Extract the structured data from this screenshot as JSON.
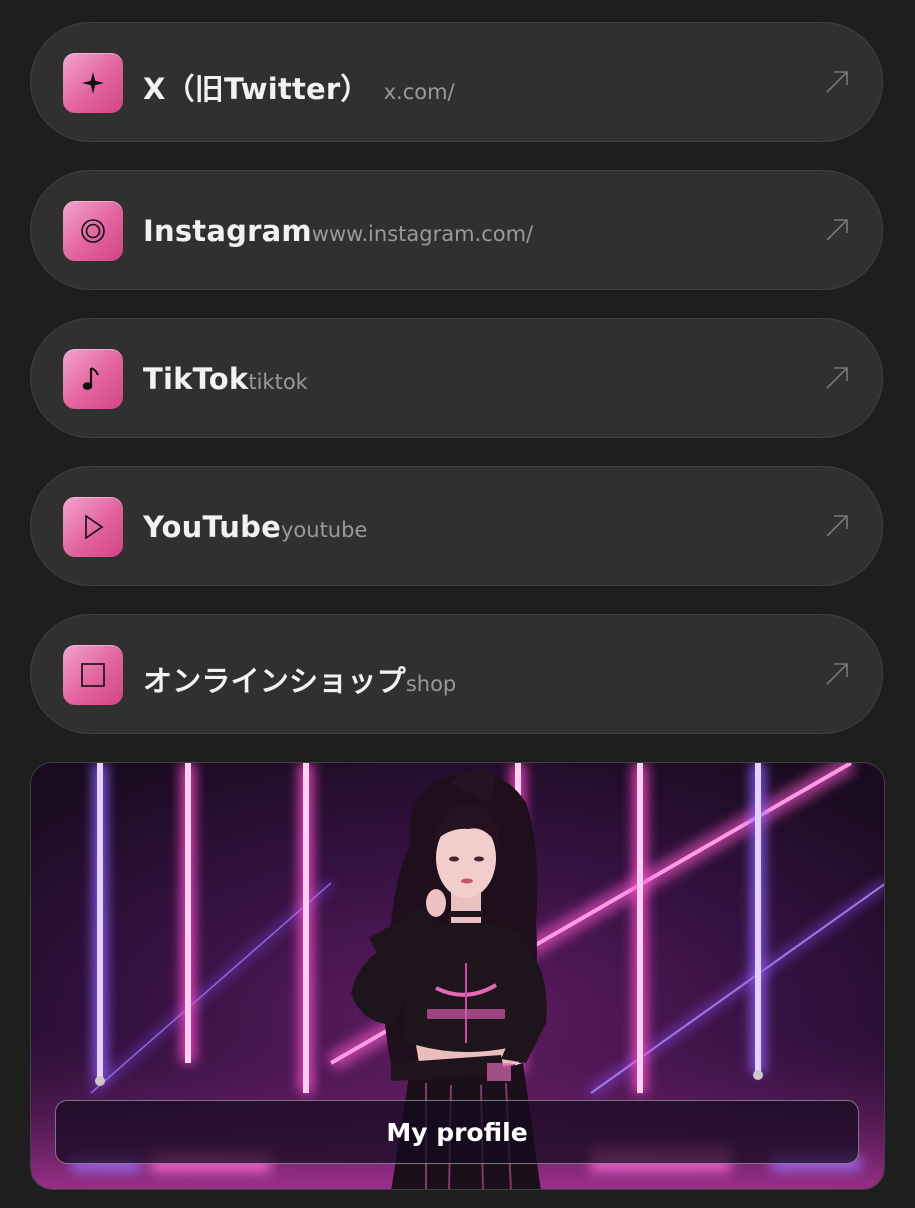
{
  "links": [
    {
      "title": "X（旧Twitter）",
      "subtitle": "x.com/",
      "icon": "sparkle-icon"
    },
    {
      "title": "Instagram",
      "subtitle": "www.instagram.com/",
      "icon": "circle-target-icon"
    },
    {
      "title": "TikTok",
      "subtitle": "tiktok",
      "icon": "music-note-icon"
    },
    {
      "title": "YouTube",
      "subtitle": "youtube",
      "icon": "play-icon"
    },
    {
      "title": "オンラインショップ",
      "subtitle": "shop",
      "icon": "square-icon"
    }
  ],
  "profile": {
    "button_label": "My profile",
    "image": "neon-stage-portrait"
  },
  "colors": {
    "background": "#1e1e1e",
    "card": "#303030",
    "card_border": "#414141",
    "icon_pink": "#e2639f",
    "title_text": "#f2f2f2",
    "subtitle_text": "#9a9a9a"
  }
}
